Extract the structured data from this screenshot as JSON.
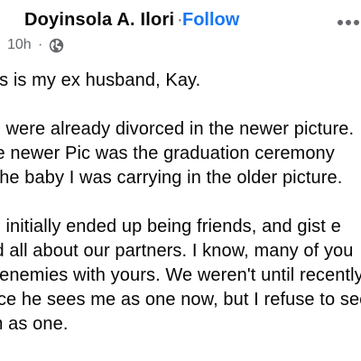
{
  "header": {
    "author": "Doyinsola A. Ilori",
    "separator": "·",
    "follow_label": "Follow",
    "more_icon": "more-horizontal-icon"
  },
  "meta": {
    "time": "10h",
    "dot": "·",
    "privacy_icon": "globe-icon"
  },
  "body": {
    "p1": [
      "This is my ex husband, Kay."
    ],
    "p2": [
      "We were already divorced in the newer picture.",
      "The newer Pic was the graduation ceremony",
      "of the baby I was carrying in the older picture."
    ],
    "p3": [
      "We initially ended up being friends, and gist e",
      "and all about our partners.  I know, many of you",
      "be enemies with yours.  We weren't until recently",
      "since he sees me as one now, but I refuse to see",
      "him as one."
    ]
  }
}
